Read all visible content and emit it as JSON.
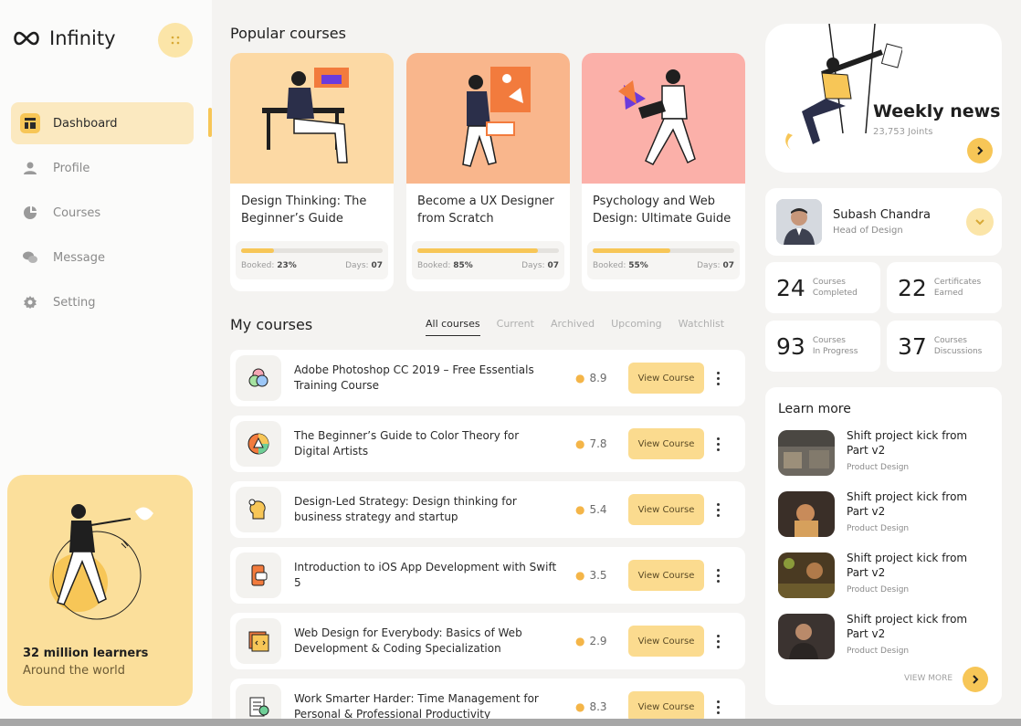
{
  "brand": {
    "name": "Infinity",
    "accent": "#f7c657"
  },
  "sidebar": {
    "items": [
      {
        "label": "Dashboard",
        "icon": "dashboard-icon",
        "active": true
      },
      {
        "label": "Profile",
        "icon": "user-icon"
      },
      {
        "label": "Courses",
        "icon": "courses-icon"
      },
      {
        "label": "Message",
        "icon": "message-icon"
      },
      {
        "label": "Setting",
        "icon": "gear-icon"
      }
    ],
    "promo": {
      "title": "32 million learners",
      "subtitle": "Around the world"
    }
  },
  "popular": {
    "title": "Popular courses",
    "cards": [
      {
        "title": "Design Thinking: The Beginner’s Guide",
        "booked_label": "Booked:",
        "booked": "23%",
        "booked_fraction": 0.23,
        "days_label": "Days:",
        "days": "07",
        "bg": "#fcd9a4"
      },
      {
        "title": "Become a UX Designer from Scratch",
        "booked_label": "Booked:",
        "booked": "85%",
        "booked_fraction": 0.85,
        "days_label": "Days:",
        "days": "07",
        "bg": "#f9b68c"
      },
      {
        "title": "Psychology and Web Design: Ultimate Guide",
        "booked_label": "Booked:",
        "booked": "55%",
        "booked_fraction": 0.55,
        "days_label": "Days:",
        "days": "07",
        "bg": "#fbb0a9"
      }
    ]
  },
  "my_courses": {
    "title": "My courses",
    "tabs": [
      "All courses",
      "Current",
      "Archived",
      "Upcoming",
      "Watchlist"
    ],
    "view_label": "View Course",
    "rows": [
      {
        "name": "Adobe Photoshop CC 2019 – Free Essentials Training Course",
        "rating": "8.9",
        "icon": "rgb-circles-icon"
      },
      {
        "name": "The Beginner’s Guide to Color Theory for Digital Artists",
        "rating": "7.8",
        "icon": "color-wheel-icon"
      },
      {
        "name": "Design-Led Strategy: Design thinking for business strategy and startup",
        "rating": "5.4",
        "icon": "head-idea-icon"
      },
      {
        "name": "Introduction to iOS App Development with Swift 5",
        "rating": "3.5",
        "icon": "phone-app-icon"
      },
      {
        "name": "Web Design for Everybody: Basics of Web Development & Coding Specialization",
        "rating": "2.9",
        "icon": "code-window-icon"
      },
      {
        "name": "Work Smarter Harder: Time Management for Personal & Professional Productivity",
        "rating": "8.3",
        "icon": "document-clock-icon"
      }
    ]
  },
  "news": {
    "title": "Weekly news",
    "subtitle": "23,753 Joints"
  },
  "profile": {
    "name": "Subash Chandra",
    "role": "Head of Design"
  },
  "stats": [
    {
      "value": "24",
      "label1": "Courses",
      "label2": "Completed"
    },
    {
      "value": "22",
      "label1": "Certificates",
      "label2": "Earned"
    },
    {
      "value": "93",
      "label1": "Courses",
      "label2": "In Progress"
    },
    {
      "value": "37",
      "label1": "Courses",
      "label2": "Discussions"
    }
  ],
  "learn_more": {
    "title": "Learn more",
    "items": [
      {
        "name": "Shift project kick from Part v2",
        "category": "Product Design"
      },
      {
        "name": "Shift project kick from Part v2",
        "category": "Product Design"
      },
      {
        "name": "Shift project kick from Part v2",
        "category": "Product Design"
      },
      {
        "name": "Shift project kick from Part v2",
        "category": "Product Design"
      }
    ],
    "view_more": "VIEW MORE"
  }
}
